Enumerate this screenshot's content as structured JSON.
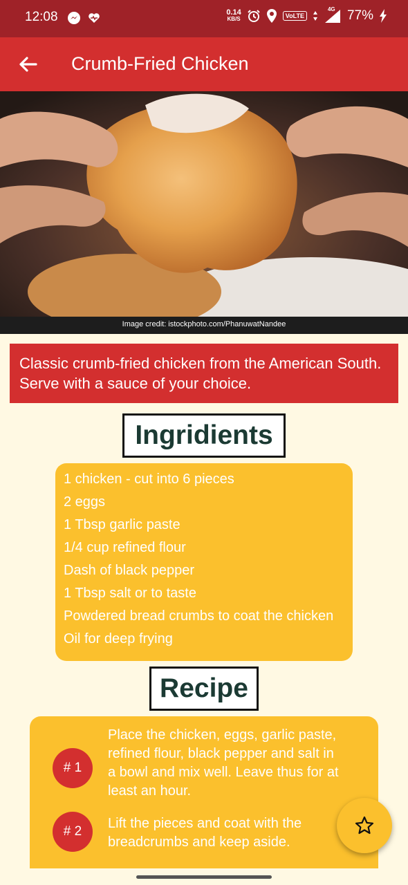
{
  "status_bar": {
    "time": "12:08",
    "net_speed_value": "0.14",
    "net_speed_unit": "KB/S",
    "volte": "VoLTE",
    "network": "4G",
    "battery": "77%"
  },
  "app_bar": {
    "title": "Crumb-Fried Chicken"
  },
  "hero": {
    "credit": "Image credit: istockphoto.com/PhanuwatNandee"
  },
  "description": "Classic crumb-fried chicken from the American South. Serve with a sauce of your choice.",
  "ingredients": {
    "title": "Ingridients",
    "items": [
      "1 chicken - cut into 6 pieces",
      "2 eggs",
      "1 Tbsp garlic paste",
      "1/4 cup refined flour",
      "Dash of black pepper",
      "1 Tbsp salt or to taste",
      "Powdered bread crumbs to coat the chicken",
      "Oil for deep frying"
    ]
  },
  "recipe": {
    "title": "Recipe",
    "steps": [
      {
        "number": "# 1",
        "text": "Place the chicken, eggs, garlic paste, refined flour, black pepper and salt in a bowl and mix well. Leave thus for at least an hour."
      },
      {
        "number": "# 2",
        "text": "Lift the pieces and coat with the breadcrumbs and keep aside."
      }
    ]
  },
  "colors": {
    "status_bar": "#9f2228",
    "primary": "#d32f2f",
    "accent": "#fbc02d",
    "background": "#fff9e3",
    "heading_text": "#1b3a33"
  },
  "icons": {
    "back": "arrow-left-icon",
    "favorite": "star-outline-icon"
  }
}
